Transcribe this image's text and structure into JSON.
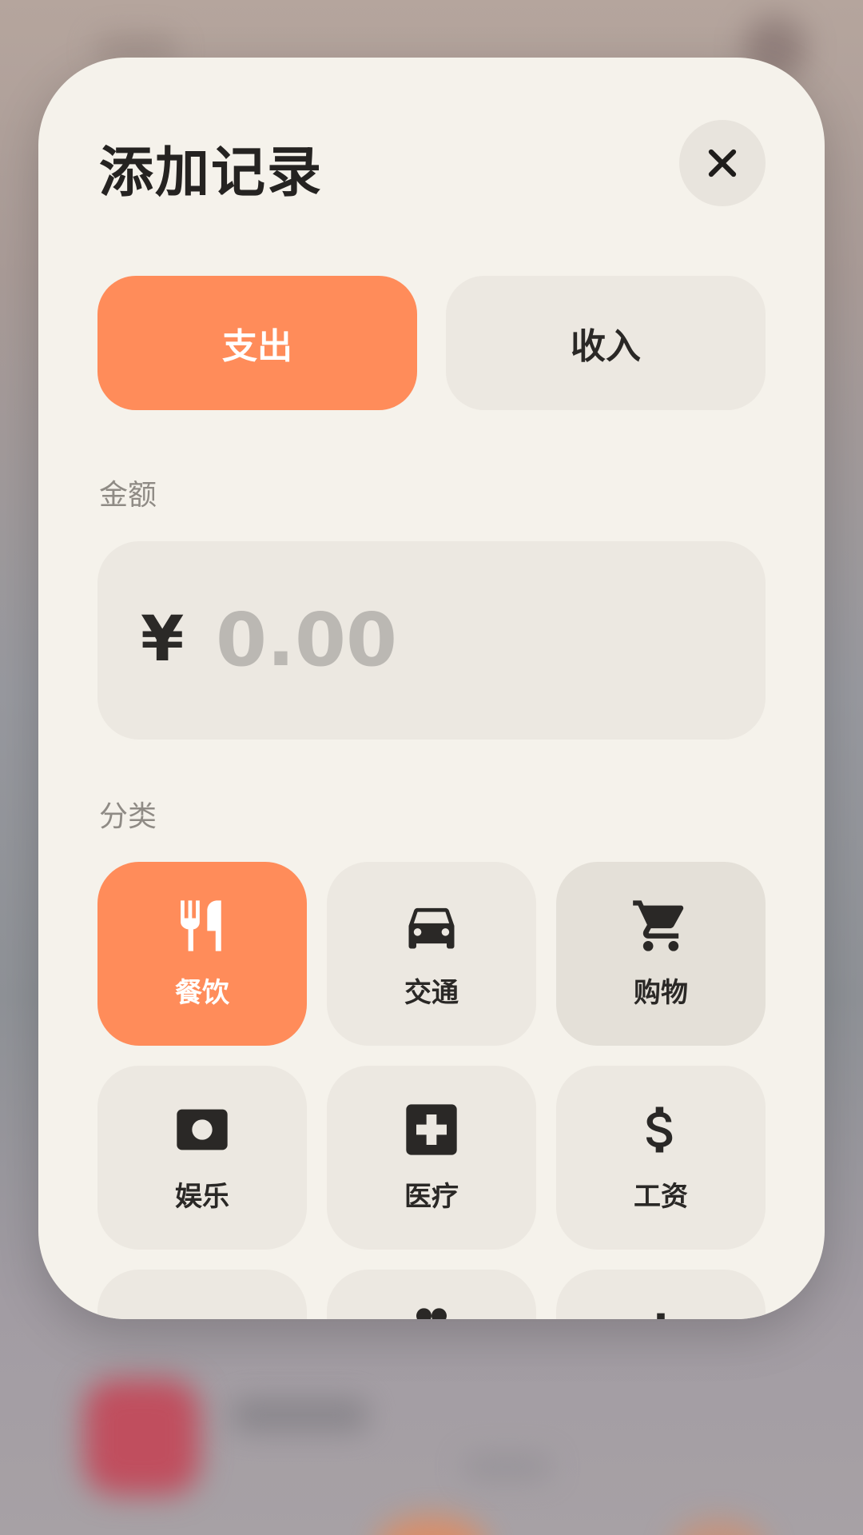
{
  "sheet": {
    "title": "添加记录",
    "close_icon": "close-icon"
  },
  "type_toggle": {
    "expense_label": "支出",
    "income_label": "收入",
    "selected": "expense"
  },
  "amount": {
    "label": "金额",
    "currency_symbol": "¥",
    "placeholder": "0.00",
    "value": ""
  },
  "category": {
    "label": "分类",
    "selected": "餐饮",
    "items": [
      {
        "label": "餐饮",
        "icon": "restaurant-icon"
      },
      {
        "label": "交通",
        "icon": "car-icon"
      },
      {
        "label": "购物",
        "icon": "shopping-cart-icon"
      },
      {
        "label": "娱乐",
        "icon": "photo-icon"
      },
      {
        "label": "医疗",
        "icon": "medical-icon"
      },
      {
        "label": "工资",
        "icon": "dollar-icon"
      }
    ]
  },
  "colors": {
    "accent": "#ff8c5a",
    "sheet_bg": "#f5f2eb",
    "tile_bg": "#ece8e1",
    "text": "#252321",
    "muted": "#8f8b85",
    "placeholder": "#bbb8b3"
  }
}
